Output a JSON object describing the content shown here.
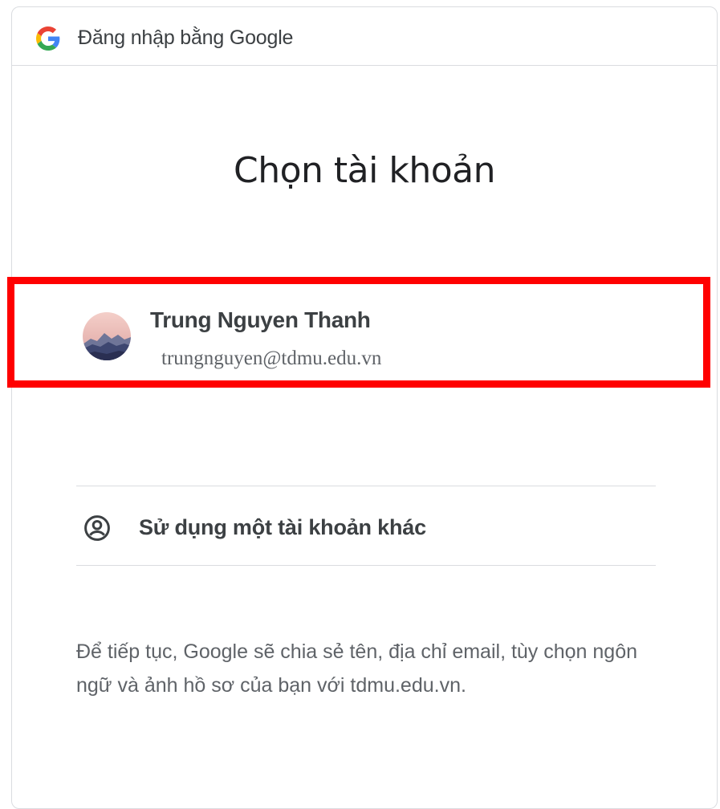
{
  "header": {
    "title": "Đăng nhập bằng Google",
    "logo_icon": "google-g-icon"
  },
  "main": {
    "title": "Chọn tài khoản",
    "accounts": [
      {
        "name": "Trung Nguyen Thanh",
        "email": "trungnguyen@tdmu.edu.vn",
        "avatar_icon": "mountain-avatar-icon"
      }
    ],
    "other_account": {
      "label": "Sử dụng một tài khoản khác",
      "icon": "account-circle-icon"
    },
    "notice": "Để tiếp tục, Google sẽ chia sẻ tên, địa chỉ email, tùy chọn ngôn ngữ và ảnh hồ sơ của bạn với tdmu.edu.vn."
  },
  "colors": {
    "highlight": "#ff0000",
    "border": "#dadce0",
    "text_primary": "#202124",
    "text_secondary": "#5f6368"
  }
}
